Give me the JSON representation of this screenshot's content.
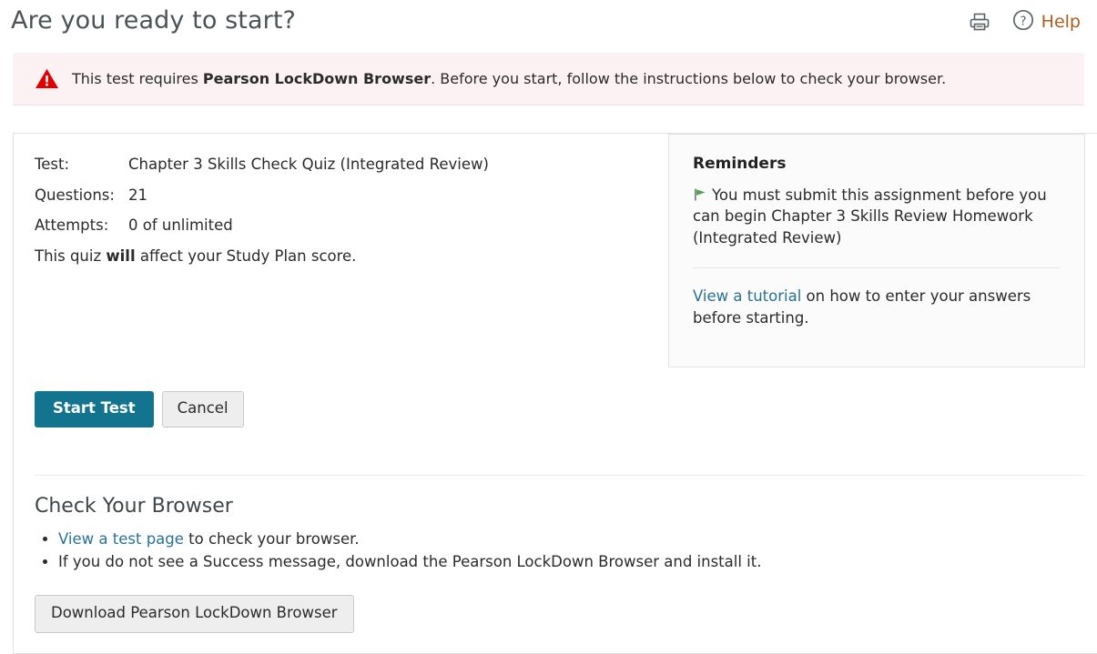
{
  "header": {
    "title": "Are you ready to start?",
    "print_icon": "print-icon",
    "help_icon": "question-circle-icon",
    "help_label": "Help"
  },
  "alert": {
    "icon": "warning-triangle-icon",
    "text_before": "This test requires ",
    "text_bold": "Pearson LockDown Browser",
    "text_after": ". Before you start, follow the instructions below to check your browser."
  },
  "details": {
    "rows": [
      {
        "label": "Test:",
        "value": "Chapter 3 Skills Check Quiz (Integrated Review)"
      },
      {
        "label": "Questions:",
        "value": "21"
      },
      {
        "label": "Attempts:",
        "value": "0 of unlimited"
      }
    ],
    "study_plan_before": "This quiz ",
    "study_plan_bold": "will",
    "study_plan_after": " affect your Study Plan score."
  },
  "reminders": {
    "title": "Reminders",
    "flag_icon": "green-flag-icon",
    "item": "You must submit this assignment before you can begin Chapter 3 Skills Review Homework (Integrated Review)",
    "tutorial_link": "View a tutorial",
    "tutorial_rest": " on how to enter your answers before starting."
  },
  "actions": {
    "start_label": "Start Test",
    "cancel_label": "Cancel"
  },
  "browser_check": {
    "heading": "Check Your Browser",
    "bullet1_link": "View a test page",
    "bullet1_rest": " to check your browser.",
    "bullet2": "If you do not see a Success message, download the Pearson LockDown Browser and install it.",
    "download_label": "Download Pearson LockDown Browser"
  },
  "colors": {
    "primary_button": "#13748f",
    "link": "#287296",
    "help_text": "#a8601e",
    "alert_bg": "#fdf2f3",
    "alert_icon": "#e00000",
    "flag": "#4aa84a"
  }
}
